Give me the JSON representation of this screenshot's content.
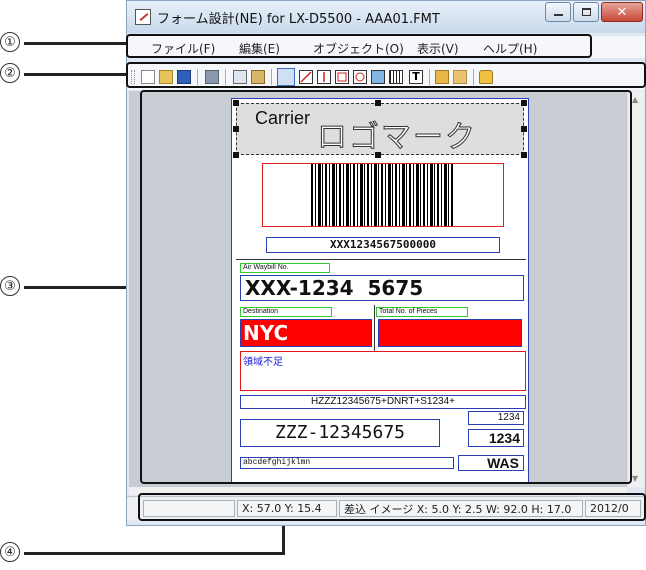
{
  "window": {
    "title": "フォーム設計(NE) for LX-D5500 - AAA01.FMT"
  },
  "menu": [
    "ファイル(F)",
    "編集(E)",
    "オブジェクト(O)",
    "表示(V)",
    "ヘルプ(H)"
  ],
  "toolbar": {
    "icons": [
      "grip-icon",
      "new-file-icon",
      "open-folder-icon",
      "save-icon",
      "print-icon",
      "copy-icon",
      "paste-icon",
      "select-icon",
      "line-tool-icon",
      "vertical-line-tool-icon",
      "rectangle-tool-icon",
      "ellipse-tool-icon",
      "image-tool-icon",
      "barcode-tool-icon",
      "text-tool-icon",
      "bring-front-icon",
      "send-back-icon",
      "lock-icon"
    ]
  },
  "callouts": [
    "①",
    "②",
    "③",
    "④"
  ],
  "label": {
    "carrier_text": "Carrier",
    "logo_text": "ロゴマーク",
    "barcode_number": "XXX1234567500000",
    "air_waybill_caption": "Air Waybill No.",
    "air_waybill_value": "XXX-1234  5675",
    "destination_caption": "Destination",
    "destination_value": "NYC",
    "pieces_caption": "Total No. of Pieces",
    "note_text": "領域不足",
    "routing_text": "HZZZ12345675+DNRT+S1234+",
    "code_value": "ZZZ-12345675",
    "small_code_top": "1234",
    "small_code_bottom": "1234",
    "alpha_text": "abcdefghijklmn",
    "was_text": "WAS"
  },
  "status": {
    "coords": "X: 57.0 Y: 15.4",
    "insert_image": "差込 イメージ X: 5.0 Y: 2.5 W: 92.0 H: 17.0",
    "date": "2012/0"
  },
  "colors": {
    "label_border": "#2a3fb4",
    "destination_fill": "#ff0000",
    "caption_border": "#33cc33",
    "note_border": "#e01818"
  }
}
